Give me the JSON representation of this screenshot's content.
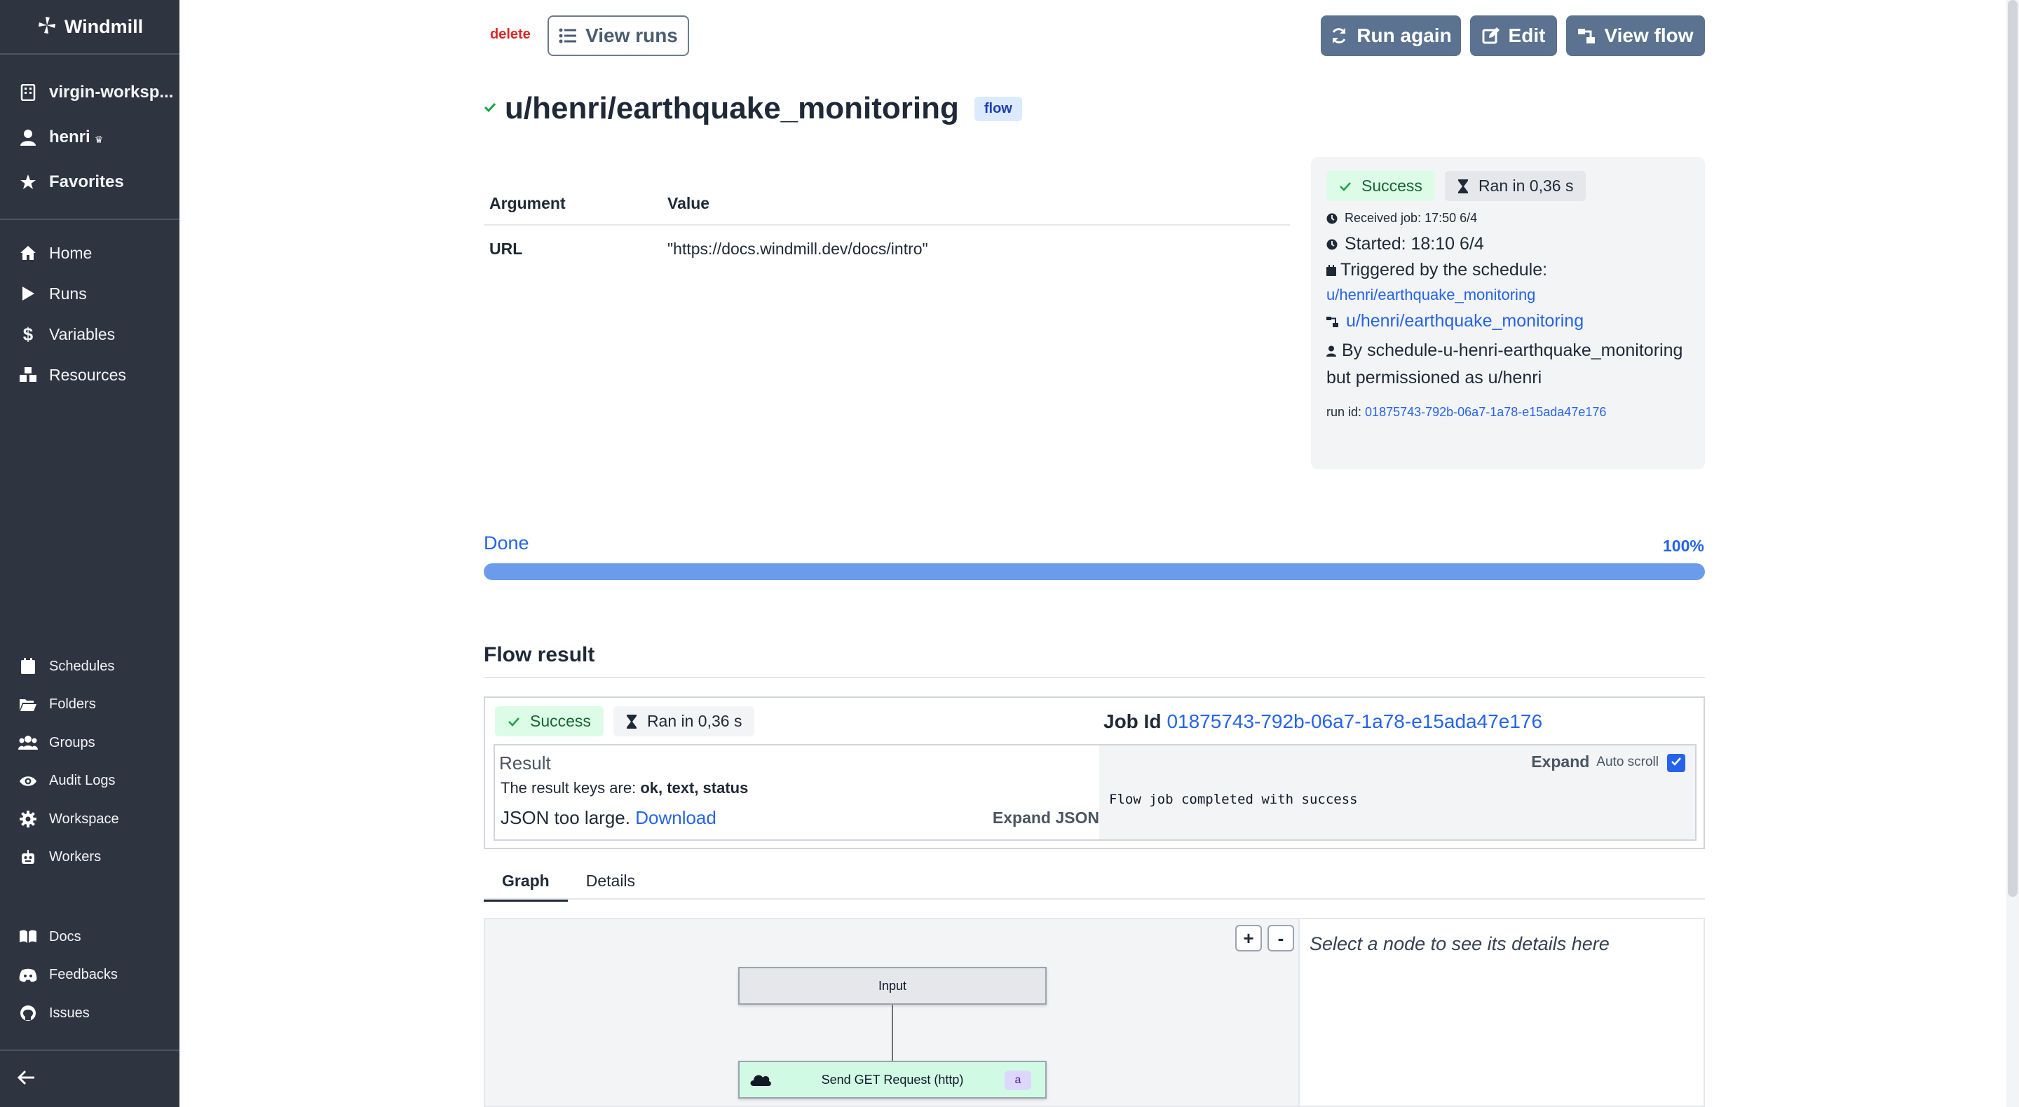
{
  "sidebar": {
    "brand": "Windmill",
    "workspace": "virgin-worksp...",
    "user": "henri",
    "favorites": "Favorites",
    "main_items": [
      {
        "label": "Home",
        "icon": "home-icon"
      },
      {
        "label": "Runs",
        "icon": "play-icon"
      },
      {
        "label": "Variables",
        "icon": "dollar-icon"
      },
      {
        "label": "Resources",
        "icon": "boxes-icon"
      }
    ],
    "admin_items": [
      {
        "label": "Schedules",
        "icon": "calendar-icon"
      },
      {
        "label": "Folders",
        "icon": "folder-open-icon"
      },
      {
        "label": "Groups",
        "icon": "users-icon"
      },
      {
        "label": "Audit Logs",
        "icon": "eye-icon"
      },
      {
        "label": "Workspace",
        "icon": "gear-icon"
      },
      {
        "label": "Workers",
        "icon": "robot-icon"
      }
    ],
    "help_items": [
      {
        "label": "Docs",
        "icon": "book-icon"
      },
      {
        "label": "Feedbacks",
        "icon": "discord-icon"
      },
      {
        "label": "Issues",
        "icon": "github-icon"
      }
    ]
  },
  "header": {
    "delete": "delete",
    "view_runs": "View runs",
    "run_again": "Run again",
    "edit": "Edit",
    "view_flow": "View flow",
    "title": "u/henri/earthquake_monitoring",
    "badge": "flow"
  },
  "args": {
    "col_argument": "Argument",
    "col_value": "Value",
    "rows": [
      {
        "name": "URL",
        "value": "\"https://docs.windmill.dev/docs/intro\""
      }
    ]
  },
  "info": {
    "status": "Success",
    "duration": "Ran in 0,36 s",
    "received": "Received job: 17:50 6/4",
    "started": "Started: 18:10 6/4",
    "triggered": "Triggered by the schedule:",
    "schedule_link": "u/henri/earthquake_monitoring",
    "flow_link": "u/henri/earthquake_monitoring",
    "by_line": "By schedule-u-henri-earthquake_monitoring but permissioned as u/henri",
    "run_id_label": "run id:",
    "run_id": "01875743-792b-06a7-1a78-e15ada47e176"
  },
  "progress": {
    "label": "Done",
    "percent_label": "100%",
    "value": 1.0
  },
  "flow_result": {
    "title": "Flow result",
    "status": "Success",
    "duration": "Ran in 0,36 s",
    "job_id_label": "Job Id",
    "job_id": "01875743-792b-06a7-1a78-e15ada47e176",
    "result_label": "Result",
    "keys_prefix": "The result keys are:",
    "keys": "ok, text, status",
    "too_large": "JSON too large.",
    "download": "Download",
    "expand_json": "Expand JSON",
    "expand": "Expand",
    "auto_scroll": "Auto scroll",
    "auto_scroll_checked": true,
    "log": "Flow job completed with success"
  },
  "tabs": [
    "Graph",
    "Details"
  ],
  "graph": {
    "zoom_in": "+",
    "zoom_out": "-",
    "node_input": "Input",
    "node_step": "Send GET Request (http)",
    "node_step_id": "a",
    "details_placeholder": "Select a node to see its details here"
  }
}
